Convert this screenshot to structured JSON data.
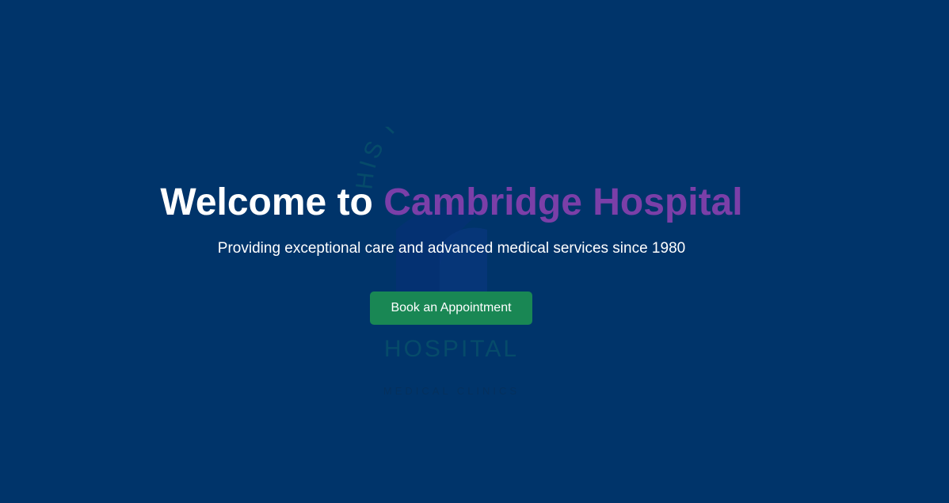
{
  "hero": {
    "title_prefix": "Welcome to",
    "title_accent": "Cambridge Hospital",
    "subtitle": "Providing exceptional care and advanced medical services since 1980",
    "cta_label": "Book an Appointment",
    "background_color": "#00346a",
    "accent_color": "#7b3fa8",
    "cta_color": "#198754"
  },
  "background_logo": {
    "arc_text": "HIS IS THE EN",
    "wordmark": "HOSPITAL",
    "tagline": "MEDICAL CLINICS"
  }
}
